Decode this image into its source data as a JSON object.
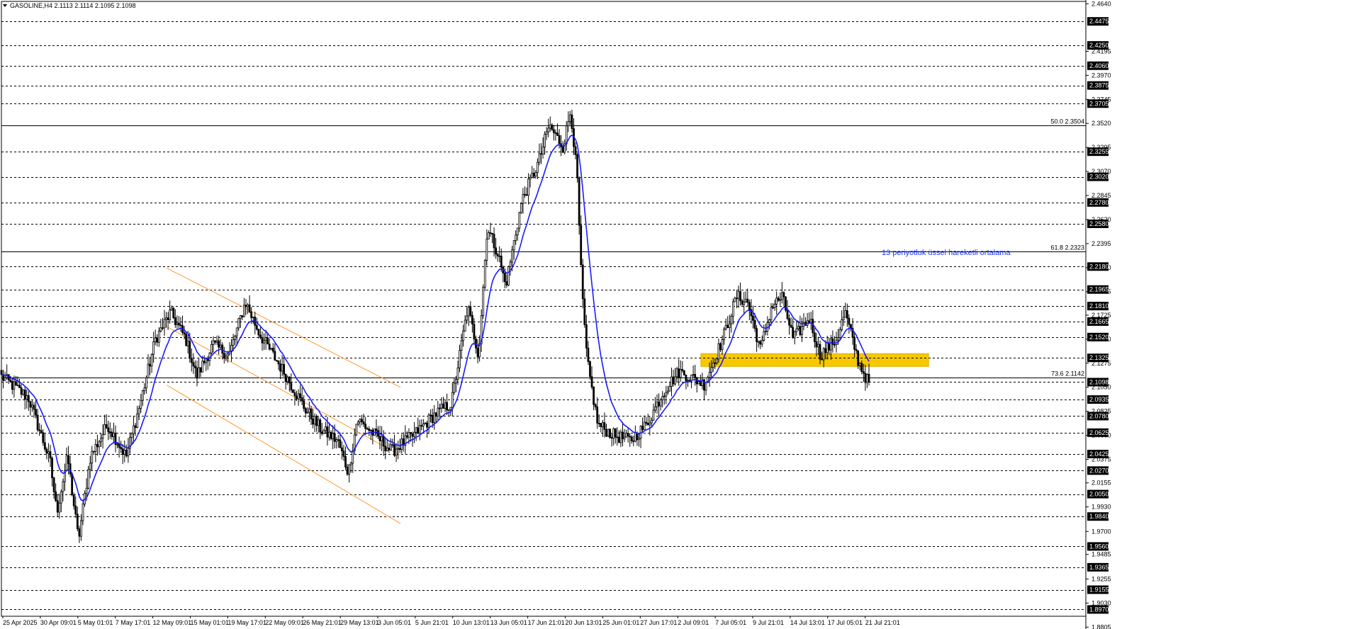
{
  "header": {
    "symbol_label": "GASOLINE,H4",
    "ohlc": "2.1113 2.1114 2.1095 2.1098"
  },
  "colors": {
    "background": "#ffffff",
    "candle": "#000000",
    "ema": "#1a1aff",
    "channel": "#ff9933",
    "zone": "#f5c800",
    "grid_line": "#000000",
    "label_bg": "#000000",
    "label_text": "#ffffff",
    "annotation": "#1a33ff"
  },
  "annotation_text": "13 periyotluk üssel hareketli ortalama",
  "chart_data": {
    "type": "candlestick",
    "title": "GASOLINE,H4",
    "ylim": [
      1.886,
      2.466
    ],
    "x_ticks": [
      "25 Apr 2025",
      "30 Apr 09:01",
      "5 May 01:01",
      "7 May 17:01",
      "12 May 09:01",
      "15 May 01:01",
      "19 May 17:01",
      "22 May 09:01",
      "26 May 21:01",
      "29 May 13:01",
      "3 Jun 05:01",
      "5 Jun 21:01",
      "10 Jun 13:01",
      "13 Jun 05:01",
      "17 Jun 21:01",
      "20 Jun 13:01",
      "25 Jun 01:01",
      "27 Jun 17:01",
      "2 Jul 09:01",
      "7 Jul 05:01",
      "9 Jul 21:01",
      "14 Jul 13:01",
      "17 Jul 05:01",
      "21 Jul 21:01"
    ],
    "y_ticks": [
      "2.4640",
      "2.4195",
      "2.3970",
      "2.3745",
      "2.3520",
      "2.3295",
      "2.3070",
      "2.2845",
      "2.2620",
      "2.2395",
      "2.2170",
      "2.1945",
      "2.1725",
      "2.1500",
      "2.1275",
      "2.1050",
      "2.0825",
      "2.0600",
      "2.0375",
      "2.0155",
      "1.9930",
      "1.9700",
      "1.9485",
      "1.9255",
      "1.9030",
      "1.8805"
    ],
    "horizontal_levels": [
      "2.4475",
      "2.4250",
      "2.4060",
      "2.3875",
      "2.3705",
      "2.3255",
      "2.3020",
      "2.2780",
      "2.2580",
      "2.2180",
      "2.1965",
      "2.1810",
      "2.1665",
      "2.1520",
      "2.1325",
      "2.1098",
      "2.0935",
      "2.0780",
      "2.0625",
      "2.0425",
      "2.0270",
      "2.0050",
      "1.9840",
      "1.9560",
      "1.9365",
      "1.9155",
      "1.8970"
    ],
    "current_price": "2.1098",
    "fib_levels": [
      {
        "label": "50.0 2.3504",
        "value": 2.3504
      },
      {
        "label": "61.8 2.2323",
        "value": 2.2323
      },
      {
        "label": "73.6 2.1142",
        "value": 2.1142
      }
    ],
    "channel": {
      "upper": [
        [
          0.1525,
          2.2165
        ],
        [
          0.368,
          2.105
        ]
      ],
      "lower": [
        [
          0.1525,
          2.107
        ],
        [
          0.368,
          1.9775
        ]
      ]
    },
    "zone": {
      "from": 0.645,
      "to": 0.855,
      "low": 2.1245,
      "high": 2.1365
    },
    "ema_period": 13,
    "anchors": [
      [
        0.0,
        2.115
      ],
      [
        0.025,
        2.095
      ],
      [
        0.045,
        2.035
      ],
      [
        0.051,
        1.988
      ],
      [
        0.061,
        2.04
      ],
      [
        0.071,
        1.962
      ],
      [
        0.082,
        2.04
      ],
      [
        0.098,
        2.07
      ],
      [
        0.115,
        2.04
      ],
      [
        0.128,
        2.09
      ],
      [
        0.142,
        2.15
      ],
      [
        0.156,
        2.175
      ],
      [
        0.17,
        2.15
      ],
      [
        0.18,
        2.115
      ],
      [
        0.195,
        2.145
      ],
      [
        0.21,
        2.135
      ],
      [
        0.225,
        2.185
      ],
      [
        0.238,
        2.155
      ],
      [
        0.26,
        2.12
      ],
      [
        0.28,
        2.085
      ],
      [
        0.295,
        2.065
      ],
      [
        0.31,
        2.055
      ],
      [
        0.32,
        2.025
      ],
      [
        0.328,
        2.075
      ],
      [
        0.345,
        2.06
      ],
      [
        0.36,
        2.045
      ],
      [
        0.38,
        2.06
      ],
      [
        0.4,
        2.08
      ],
      [
        0.415,
        2.09
      ],
      [
        0.43,
        2.18
      ],
      [
        0.44,
        2.135
      ],
      [
        0.448,
        2.255
      ],
      [
        0.458,
        2.23
      ],
      [
        0.465,
        2.2
      ],
      [
        0.48,
        2.28
      ],
      [
        0.495,
        2.315
      ],
      [
        0.505,
        2.35
      ],
      [
        0.518,
        2.33
      ],
      [
        0.525,
        2.365
      ],
      [
        0.531,
        2.3
      ],
      [
        0.535,
        2.2
      ],
      [
        0.54,
        2.13
      ],
      [
        0.55,
        2.07
      ],
      [
        0.565,
        2.06
      ],
      [
        0.58,
        2.055
      ],
      [
        0.595,
        2.07
      ],
      [
        0.61,
        2.1
      ],
      [
        0.625,
        2.12
      ],
      [
        0.648,
        2.108
      ],
      [
        0.665,
        2.15
      ],
      [
        0.678,
        2.19
      ],
      [
        0.688,
        2.185
      ],
      [
        0.7,
        2.14
      ],
      [
        0.71,
        2.18
      ],
      [
        0.72,
        2.19
      ],
      [
        0.73,
        2.15
      ],
      [
        0.745,
        2.17
      ],
      [
        0.755,
        2.135
      ],
      [
        0.77,
        2.15
      ],
      [
        0.778,
        2.175
      ],
      [
        0.79,
        2.13
      ],
      [
        0.798,
        2.112
      ],
      [
        0.8,
        2.1098
      ]
    ],
    "candle_count": 480
  }
}
